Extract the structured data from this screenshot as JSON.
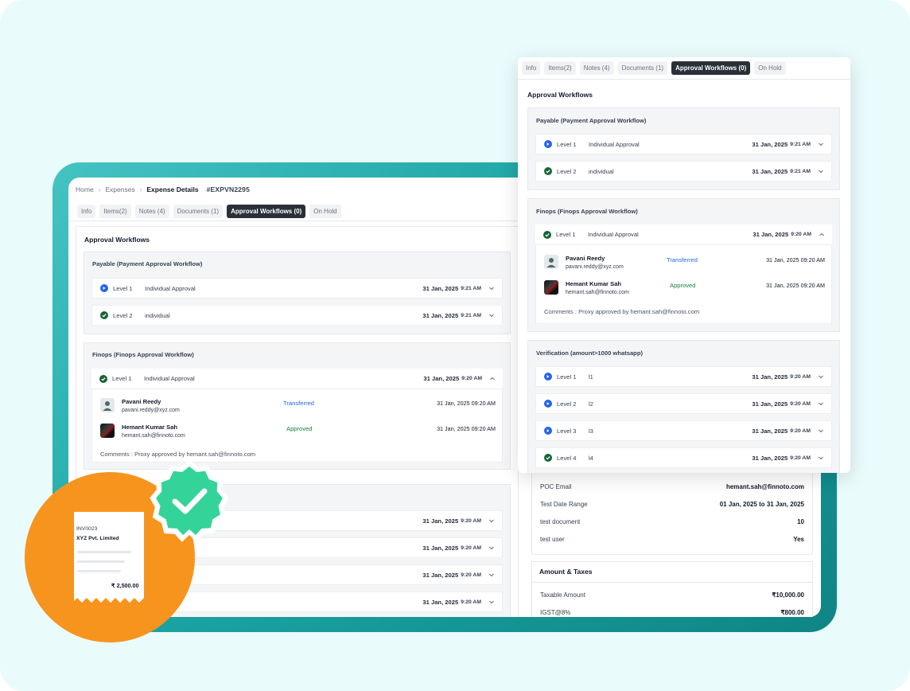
{
  "breadcrumb": {
    "home": "Home",
    "expenses": "Expenses",
    "current": "Expense Details",
    "doc_id": "#EXPVN2295"
  },
  "tabs": {
    "info": "Info",
    "items": "Items(2)",
    "notes": "Notes (4)",
    "documents": "Documents (1)",
    "approval": "Approval Workflows (0)",
    "on_hold": "On Hold"
  },
  "approval": {
    "title": "Approval Workflows",
    "payable": {
      "title": "Payable (Payment Approval Workflow)",
      "levels": [
        {
          "level": "Level 1",
          "name": "Individual Approval",
          "date": "31 Jan, 2025",
          "time": "9:21 AM",
          "icon": "play-icon"
        },
        {
          "level": "Level 2",
          "name": "individual",
          "date": "31 Jan, 2025",
          "time": "9:21 AM",
          "icon": "check-icon"
        }
      ]
    },
    "finops": {
      "title": "Finops (Finops Approval Workflow)",
      "level": {
        "level": "Level 1",
        "name": "Individual Approval",
        "date": "31 Jan, 2025",
        "time": "9:20 AM"
      },
      "approvers": [
        {
          "name": "Pavani Reedy",
          "email": "pavani.reddy@xyz.com",
          "status": "Transferred",
          "datetime": "31 Jan, 2025 09:20 AM"
        },
        {
          "name": "Hemant Kumar Sah",
          "email": "hemant.sah@finnoto.com",
          "status": "Approved",
          "datetime": "31 Jan, 2025 09:20 AM"
        }
      ],
      "comments_label": "Comments :",
      "comments_text": "Proxy approved by hemant.sah@finnoto.com"
    },
    "verification": {
      "title": "Verification (amount>1000 whatsapp)",
      "levels": [
        {
          "level": "Level 1",
          "name": "l1",
          "date": "31 Jan, 2025",
          "time": "9:20 AM",
          "icon": "play-icon"
        },
        {
          "level": "Level 2",
          "name": "l2",
          "date": "31 Jan, 2025",
          "time": "9:20 AM",
          "icon": "play-icon"
        },
        {
          "level": "Level 3",
          "name": "l3",
          "date": "31 Jan, 2025",
          "time": "9:20 AM",
          "icon": "play-icon"
        },
        {
          "level": "Level 4",
          "name": "l4",
          "date": "31 Jan, 2025",
          "time": "9:20 AM",
          "icon": "check-icon"
        }
      ]
    },
    "hidden_rows": [
      {
        "date": "31 Jan, 2025",
        "time": "9:20 AM"
      },
      {
        "date": "31 Jan, 2025",
        "time": "9:20 AM"
      },
      {
        "date": "31 Jan, 2025",
        "time": "9:20 AM"
      },
      {
        "date": "31 Jan, 2025",
        "time": "9:20 AM"
      }
    ]
  },
  "details": {
    "rows": [
      {
        "key": "POC Email",
        "value": "hemant.sah@finnoto.com"
      },
      {
        "key": "Test Date Range",
        "value": "01 Jan, 2025 to 31 Jan, 2025"
      },
      {
        "key": "test document",
        "value": "10"
      },
      {
        "key": "test user",
        "value": "Yes"
      }
    ],
    "amount_title": "Amount & Taxes",
    "amount_rows": [
      {
        "key": "Taxable Amount",
        "value": "₹10,000.00"
      },
      {
        "key": "IGST@8%",
        "value": "₹800.00"
      }
    ]
  },
  "receipt": {
    "invoice_no": "INV0023",
    "company": "XYZ Pvt. Limited",
    "amount": "₹ 2,500.00"
  },
  "colors": {
    "accent_teal": "#1aa3a3",
    "play_blue": "#2563eb",
    "check_green": "#166534",
    "badge_orange": "#f7941d",
    "badge_green": "#34d399"
  }
}
